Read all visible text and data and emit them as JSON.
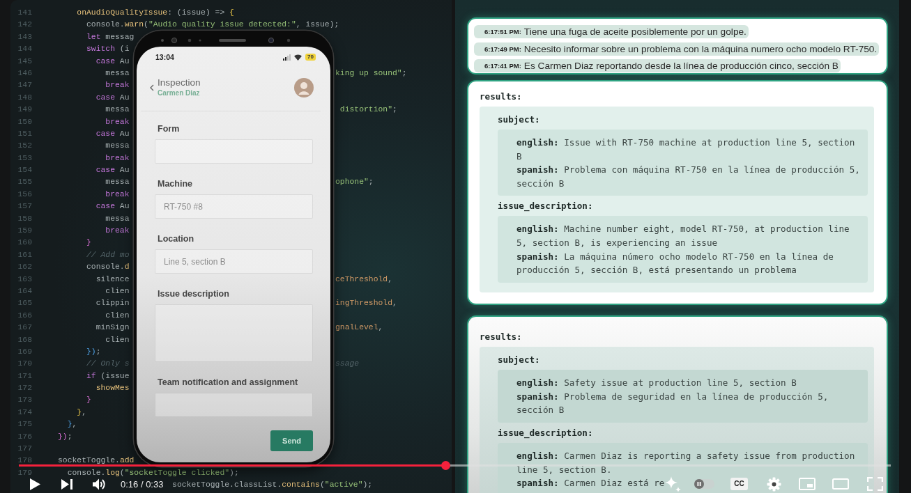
{
  "code_editor": {
    "lines": [
      {
        "number": "141",
        "kind": "full",
        "code": [
          {
            "kind": "function",
            "text": "    onAudioQualityIssue"
          },
          {
            "text": ": (issue) => "
          },
          {
            "kind": "bracket-gold",
            "text": "{"
          }
        ]
      },
      {
        "number": "142",
        "kind": "full",
        "code": [
          {
            "text": "      console."
          },
          {
            "kind": "function",
            "text": "warn"
          },
          {
            "text": "("
          },
          {
            "kind": "string",
            "text": "\"Audio quality issue detected:\""
          },
          {
            "text": ", issue);"
          }
        ]
      },
      {
        "number": "143",
        "kind": "beside-phone",
        "code": [
          {
            "kind": "keyword",
            "text": "      let"
          },
          {
            "text": " messag"
          }
        ]
      },
      {
        "number": "144",
        "kind": "beside-phone",
        "code": [
          {
            "kind": "keyword",
            "text": "      switch"
          },
          {
            "text": " (i"
          }
        ]
      },
      {
        "number": "145",
        "kind": "beside-phone",
        "code": [
          {
            "kind": "keyword",
            "text": "        case"
          },
          {
            "text": " Au"
          }
        ]
      },
      {
        "number": "146",
        "kind": "beside-phone",
        "code": [
          {
            "text": "          messa"
          }
        ],
        "tail": [
          {
            "kind": "string",
            "text": "king up sound\""
          },
          {
            "text": ";"
          }
        ]
      },
      {
        "number": "147",
        "kind": "beside-phone",
        "code": [
          {
            "kind": "keyword",
            "text": "          break"
          }
        ]
      },
      {
        "number": "148",
        "kind": "beside-phone",
        "code": [
          {
            "kind": "keyword",
            "text": "        case"
          },
          {
            "text": " Au"
          }
        ]
      },
      {
        "number": "149",
        "kind": "beside-phone",
        "code": [
          {
            "text": "          messa"
          }
        ],
        "tail": [
          {
            "kind": "string",
            "text": " distortion\""
          },
          {
            "text": ";"
          }
        ]
      },
      {
        "number": "150",
        "kind": "beside-phone",
        "code": [
          {
            "kind": "keyword",
            "text": "          break"
          }
        ]
      },
      {
        "number": "151",
        "kind": "beside-phone",
        "code": [
          {
            "kind": "keyword",
            "text": "        case"
          },
          {
            "text": " Au"
          }
        ]
      },
      {
        "number": "152",
        "kind": "beside-phone",
        "code": [
          {
            "text": "          messa"
          }
        ]
      },
      {
        "number": "153",
        "kind": "beside-phone",
        "code": [
          {
            "kind": "keyword",
            "text": "          break"
          }
        ]
      },
      {
        "number": "154",
        "kind": "beside-phone",
        "code": [
          {
            "kind": "keyword",
            "text": "        case"
          },
          {
            "text": " Au"
          }
        ]
      },
      {
        "number": "155",
        "kind": "beside-phone",
        "code": [
          {
            "text": "          messa"
          }
        ],
        "tail": [
          {
            "kind": "string",
            "text": "ophone\""
          },
          {
            "text": ";"
          }
        ]
      },
      {
        "number": "156",
        "kind": "beside-phone",
        "code": [
          {
            "kind": "keyword",
            "text": "          break"
          }
        ]
      },
      {
        "number": "157",
        "kind": "beside-phone",
        "code": [
          {
            "kind": "keyword",
            "text": "        case"
          },
          {
            "text": " Au"
          }
        ]
      },
      {
        "number": "158",
        "kind": "beside-phone",
        "code": [
          {
            "text": "          messa"
          }
        ]
      },
      {
        "number": "159",
        "kind": "beside-phone",
        "code": [
          {
            "kind": "keyword",
            "text": "          break"
          }
        ]
      },
      {
        "number": "160",
        "kind": "beside-phone",
        "code": [
          {
            "kind": "bracket",
            "text": "      }"
          }
        ]
      },
      {
        "number": "161",
        "kind": "beside-phone",
        "code": [
          {
            "kind": "comment",
            "text": "      // Add mo"
          }
        ]
      },
      {
        "number": "162",
        "kind": "beside-phone",
        "code": [
          {
            "text": "      console."
          },
          {
            "kind": "function",
            "text": "d"
          }
        ]
      },
      {
        "number": "163",
        "kind": "beside-phone",
        "code": [
          {
            "text": "        silence"
          }
        ],
        "tail": [
          {
            "kind": "property",
            "text": "ceThreshold"
          },
          {
            "text": ","
          }
        ]
      },
      {
        "number": "164",
        "kind": "beside-phone",
        "code": [
          {
            "text": "          clien"
          }
        ]
      },
      {
        "number": "165",
        "kind": "beside-phone",
        "code": [
          {
            "text": "        clippin"
          }
        ],
        "tail": [
          {
            "kind": "property",
            "text": "ingThreshold"
          },
          {
            "text": ","
          }
        ]
      },
      {
        "number": "166",
        "kind": "beside-phone",
        "code": [
          {
            "text": "          clien"
          }
        ]
      },
      {
        "number": "167",
        "kind": "beside-phone",
        "code": [
          {
            "text": "        minSign"
          }
        ],
        "tail": [
          {
            "kind": "property",
            "text": "gnalLevel"
          },
          {
            "text": ","
          }
        ]
      },
      {
        "number": "168",
        "kind": "beside-phone",
        "code": [
          {
            "text": "          clien"
          }
        ]
      },
      {
        "number": "169",
        "kind": "beside-phone",
        "code": [
          {
            "kind": "bracket-blue",
            "text": "      })"
          },
          {
            "text": ";"
          }
        ]
      },
      {
        "number": "170",
        "kind": "beside-phone",
        "code": [
          {
            "kind": "comment",
            "text": "      // Only s"
          }
        ],
        "tail": [
          {
            "kind": "comment",
            "text": "ssage"
          }
        ]
      },
      {
        "number": "171",
        "kind": "beside-phone",
        "code": [
          {
            "kind": "keyword",
            "text": "      if"
          },
          {
            "text": " (issue"
          }
        ]
      },
      {
        "number": "172",
        "kind": "beside-phone",
        "code": [
          {
            "kind": "function",
            "text": "        showMes"
          }
        ]
      },
      {
        "number": "173",
        "kind": "beside-phone",
        "code": [
          {
            "kind": "bracket",
            "text": "      }"
          }
        ]
      },
      {
        "number": "174",
        "kind": "beside-phone",
        "code": [
          {
            "kind": "bracket-gold",
            "text": "    }"
          },
          {
            "text": ","
          }
        ]
      },
      {
        "number": "175",
        "kind": "beside-phone",
        "code": [
          {
            "kind": "bracket-blue",
            "text": "  }"
          },
          {
            "text": ","
          }
        ]
      },
      {
        "number": "176",
        "kind": "beside-phone",
        "code": [
          {
            "kind": "bracket",
            "text": "})"
          },
          {
            "text": ";"
          }
        ]
      },
      {
        "number": "177",
        "kind": "beside-phone"
      },
      {
        "number": "178",
        "kind": "beside-phone",
        "code": [
          {
            "text": "socketToggle."
          },
          {
            "kind": "function",
            "text": "add"
          }
        ]
      },
      {
        "number": "179",
        "kind": "full",
        "code": [
          {
            "text": "  console."
          },
          {
            "kind": "function",
            "text": "log"
          },
          {
            "text": "("
          },
          {
            "kind": "string",
            "text": "\"socketToggle clicked\""
          },
          {
            "text": ");"
          }
        ]
      },
      {
        "kind": "full",
        "code": [
          {
            "text": "                        socketToggle.classList."
          },
          {
            "kind": "function",
            "text": "contains"
          },
          {
            "text": "("
          },
          {
            "kind": "string",
            "text": "\"active\""
          },
          {
            "text": ");"
          }
        ]
      }
    ]
  },
  "phone": {
    "status_bar": {
      "time": "13:04",
      "battery": "70"
    },
    "header": {
      "title": "Inspection",
      "subtitle": "Carmen Diaz"
    },
    "fields": [
      {
        "label": "Form",
        "kind": "input"
      },
      {
        "label": "Machine",
        "kind": "input",
        "value": "RT-750 #8"
      },
      {
        "label": "Location",
        "kind": "input",
        "value": "Line 5, section B"
      },
      {
        "label": "Issue description",
        "kind": "textarea"
      },
      {
        "label": "Team notification and assignment",
        "kind": "input"
      }
    ],
    "send_button": "Send"
  },
  "transcript": {
    "entries": [
      {
        "time": "6:17:51 PM:",
        "text": "Tiene una fuga de aceite posiblemente por un golpe."
      },
      {
        "time": "6:17:49 PM:",
        "text": "Necesito informar sobre un problema con la máquina numero ocho modelo RT-750."
      },
      {
        "time": "6:17:41 PM:",
        "text": "Es Carmen Diaz reportando desde la línea de producción cinco, sección B"
      }
    ]
  },
  "results_cards": [
    {
      "heading": "results:",
      "sections": [
        {
          "heading": "subject:",
          "lines": [
            "**english:** Issue with RT-750 machine at production line 5, section B",
            "**spanish:** Problema con máquina RT-750 en la línea de producción 5, sección B"
          ]
        },
        {
          "heading": "issue_description:",
          "lines": [
            "**english:** Machine number eight, model RT-750, at production line 5, section B, is experiencing an issue",
            "**spanish:** La máquina número ocho modelo RT-750 en la línea de producción 5, sección B, está presentando un problema"
          ]
        }
      ]
    },
    {
      "heading": "results:",
      "sections": [
        {
          "heading": "subject:",
          "lines": [
            "**english:** Safety issue at production line 5, section B",
            "**spanish:** Problema de seguridad en la línea de producción 5, sección B"
          ]
        },
        {
          "heading": "issue_description:",
          "lines": [
            "**english:** Carmen Diaz is reporting a safety issue from production line 5, section B.",
            "**spanish:** Carmen Diaz está re"
          ]
        }
      ]
    }
  ],
  "player": {
    "progress": {
      "level": 0.49
    },
    "time": "0:16 / 0:33",
    "autoplay": {
      "on": false
    },
    "captions_label": "CC"
  }
}
